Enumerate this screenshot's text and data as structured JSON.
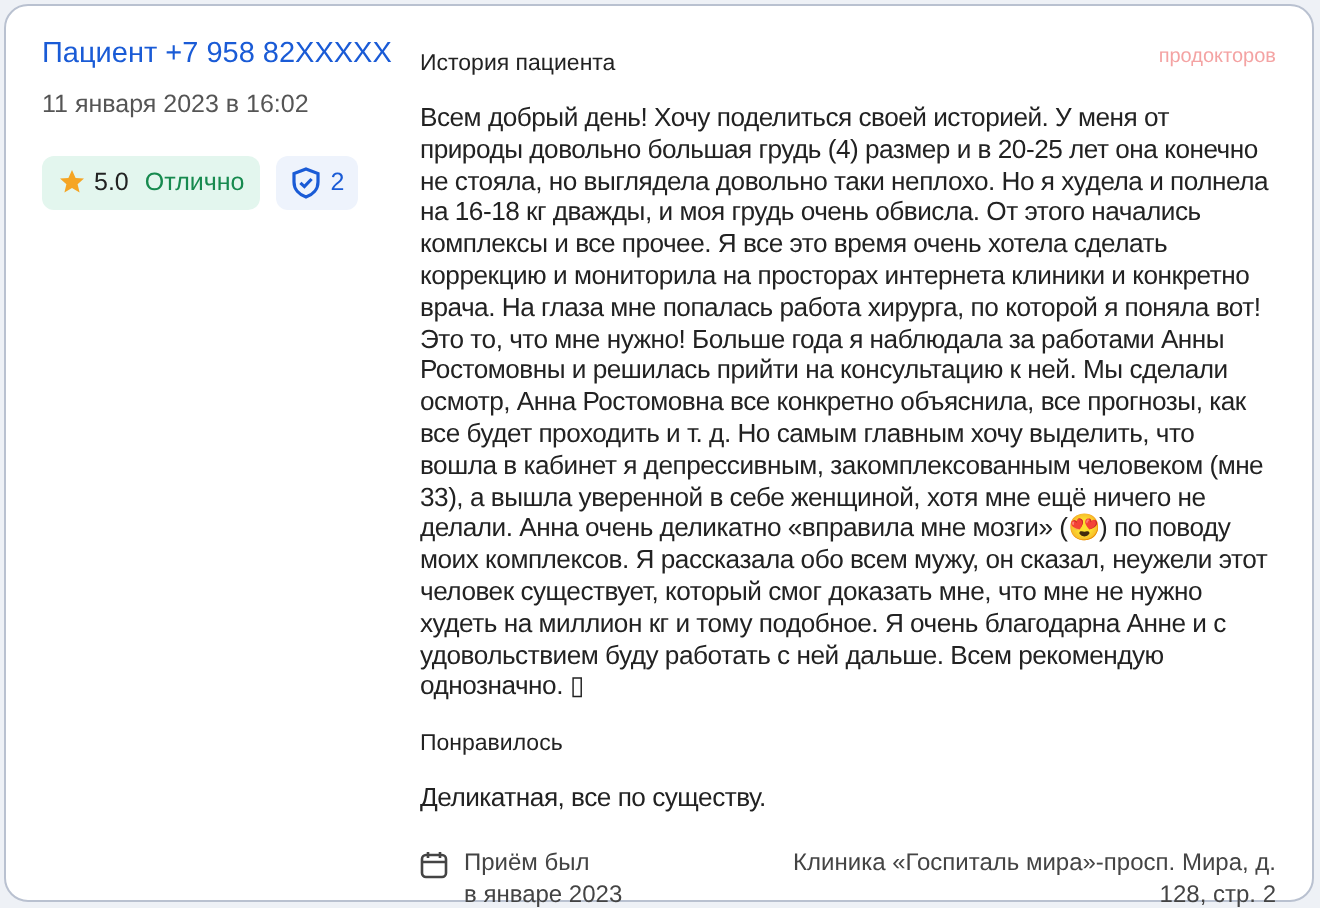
{
  "author": {
    "name": "Пациент +7 958 82XXXXX",
    "date": "11 января 2023 в 16:02"
  },
  "rating": {
    "score": "5.0",
    "label": "Отлично"
  },
  "verified": {
    "count": "2"
  },
  "story": {
    "heading": "История пациента",
    "brand": "продокторов",
    "text": "Всем добрый день! Хочу поделиться своей историей. У меня от природы довольно большая грудь (4) размер и в 20-25 лет она конечно не стояла, но выглядела довольно таки неплохо. Но я худела и полнела на 16-18 кг дважды, и моя грудь очень обвисла. От этого начались комплексы и все прочее. Я все это время очень хотела сделать коррекцию и мониторила на просторах интернета клиники и конкретно врача. На глаза мне попалась работа хирурга, по которой я поняла вот! Это то, что мне нужно! Больше года я наблюдала за работами Анны Ростомовны и решилась прийти на консультацию к ней. Мы сделали осмотр, Анна Ростомовна все конкретно объяснила, все прогнозы, как все будет проходить и т. д. Но самым главным хочу выделить, что вошла в кабинет я депрессивным, закомплексованным человеком (мне 33), а вышла уверенной в себе женщиной, хотя мне ещё ничего не делали. Анна очень деликатно «вправила мне мозги» (😍) по поводу моих комплексов. Я рассказала обо всем мужу, он сказал, неужели этот человек существует, который смог доказать мне, что мне не нужно худеть на миллион кг и тому подобное. Я очень благодарна Анне и с удовольствием буду работать с ней дальше. Всем рекомендую однозначно. ▯"
  },
  "liked": {
    "heading": "Понравилось",
    "text": "Деликатная, все по существу."
  },
  "visit": {
    "line1": "Приём был",
    "line2": "в январе 2023",
    "clinic": "Клиника «Госпиталь мира»-просп. Мира, д. 128, стр. 2"
  }
}
